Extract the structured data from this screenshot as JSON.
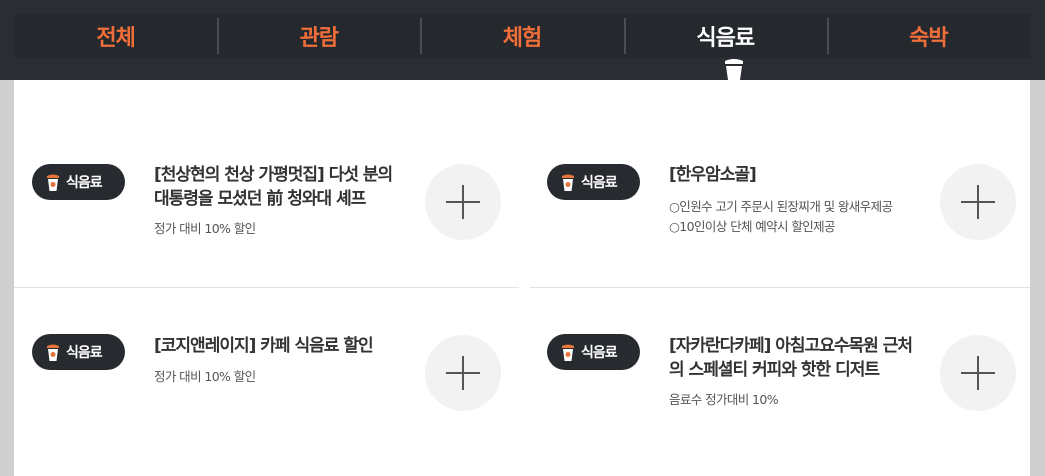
{
  "tabs": [
    {
      "label": "전체",
      "active": false
    },
    {
      "label": "관람",
      "active": false
    },
    {
      "label": "체험",
      "active": false
    },
    {
      "label": "식음료",
      "active": true
    },
    {
      "label": "숙박",
      "active": false
    }
  ],
  "items": [
    {
      "category": "식음료",
      "title": "[천상현의 천상 가평멋집] 다섯 분의 대통령을 모셨던 前 청와대 셰프",
      "description": "정가 대비 10% 할인"
    },
    {
      "category": "식음료",
      "title": "[한우암소골]",
      "description": "○인원수 고기 주문시 된장찌개 및 왕새우제공\n○10인이상 단체 예약시 할인제공"
    },
    {
      "category": "식음료",
      "title": "[코지앤레이지] 카페 식음료 할인",
      "description": "정가 대비 10% 할인"
    },
    {
      "category": "식음료",
      "title": "[자카란다카페] 아침고요수목원 근처의 스페셜티 커피와 핫한 디저트",
      "description": "음료수 정가대비 10%"
    }
  ],
  "colors": {
    "accent": "#f06e3a",
    "dark": "#272a2f",
    "cup": "#e8743b"
  },
  "icons": {
    "badge_icon": "coffee-cup-icon",
    "add_icon": "plus-icon"
  }
}
